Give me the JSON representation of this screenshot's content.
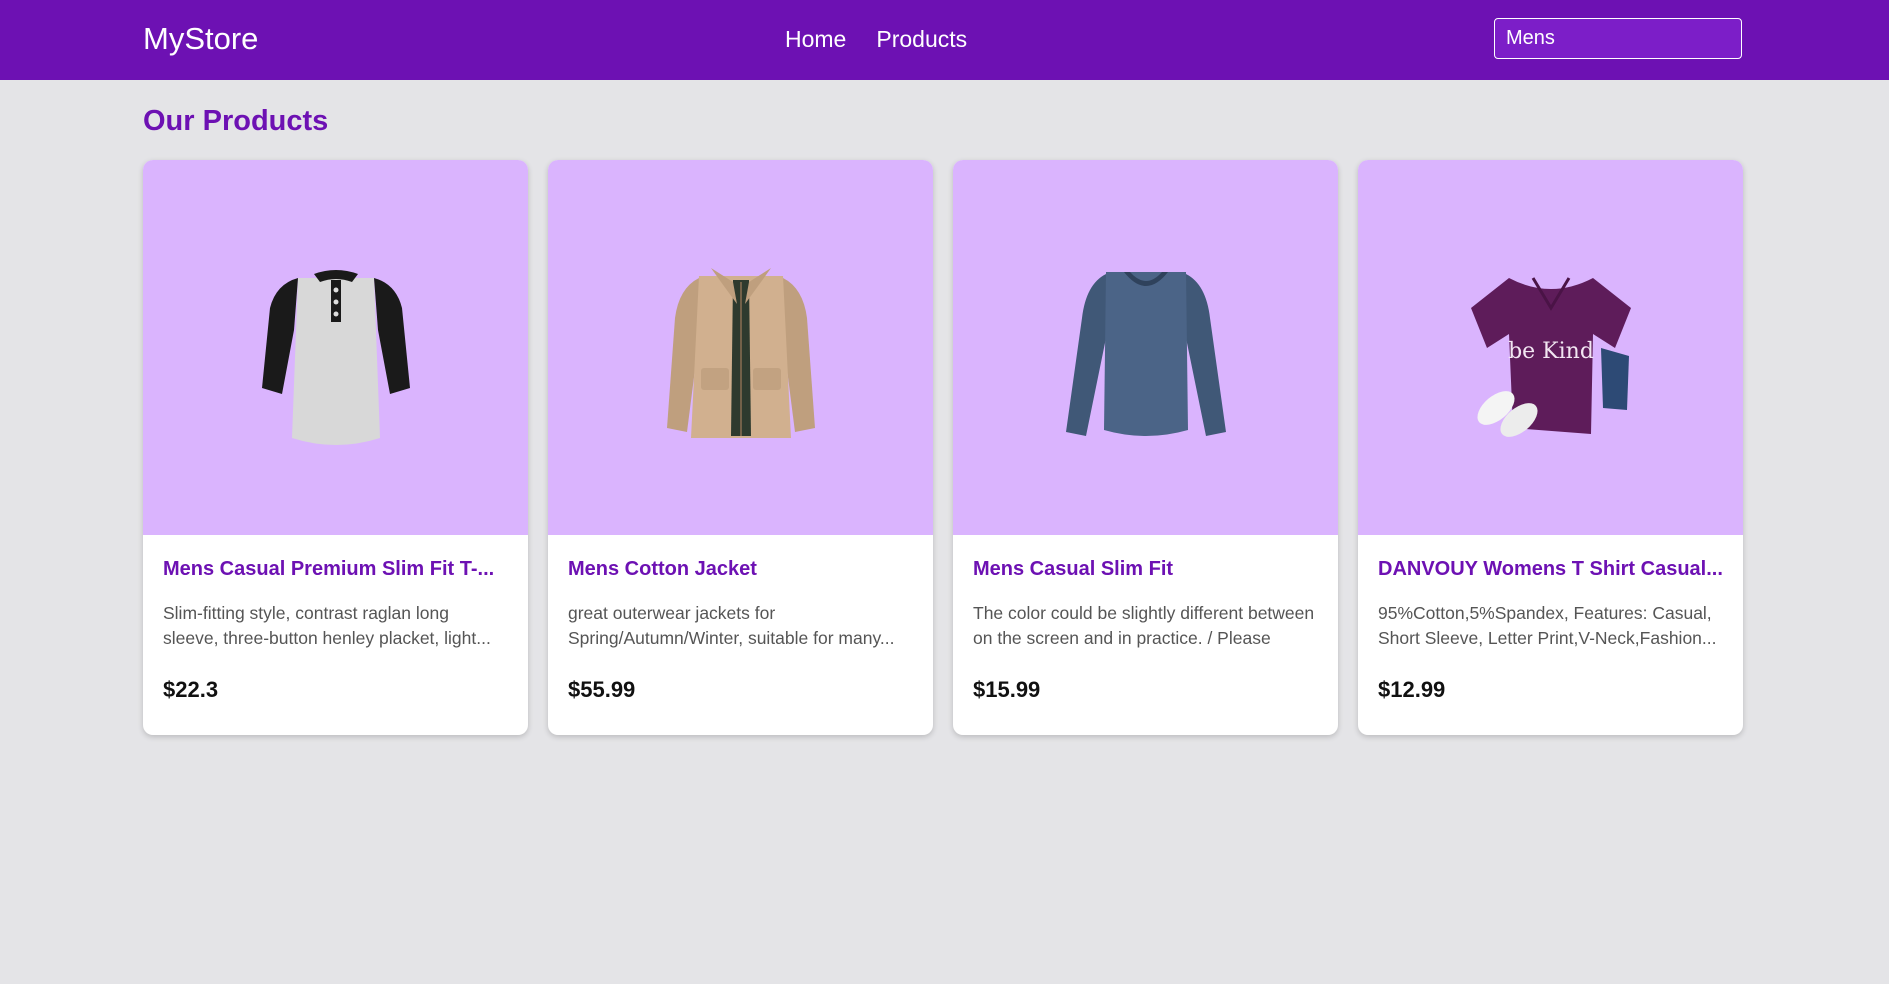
{
  "header": {
    "brand": "MyStore",
    "nav": [
      {
        "label": "Home"
      },
      {
        "label": "Products"
      }
    ],
    "search": {
      "value": "Mens",
      "placeholder": ""
    }
  },
  "main": {
    "title": "Our Products"
  },
  "products": [
    {
      "title": "Mens Casual Premium Slim Fit T-...",
      "description": "Slim-fitting style, contrast raglan long sleeve, three-button henley placket, light...",
      "price": "$22.3",
      "image_icon": "henley-raglan-shirt-icon"
    },
    {
      "title": "Mens Cotton Jacket",
      "description": "great outerwear jackets for Spring/Autumn/Winter, suitable for many...",
      "price": "$55.99",
      "image_icon": "cotton-jacket-icon"
    },
    {
      "title": "Mens Casual Slim Fit",
      "description": "The color could be slightly different between on the screen and in practice. / Please note...",
      "price": "$15.99",
      "image_icon": "long-sleeve-shirt-icon"
    },
    {
      "title": "DANVOUY Womens T Shirt Casual...",
      "description": "95%Cotton,5%Spandex, Features: Casual, Short Sleeve, Letter Print,V-Neck,Fashion...",
      "price": "$12.99",
      "image_icon": "womens-tshirt-icon",
      "image_print_text": "be Kind"
    }
  ],
  "colors": {
    "nav_bg": "#6d11b3",
    "accent": "#6d11b3",
    "image_bg": "#dab4fe",
    "page_bg": "#e4e4e7"
  }
}
